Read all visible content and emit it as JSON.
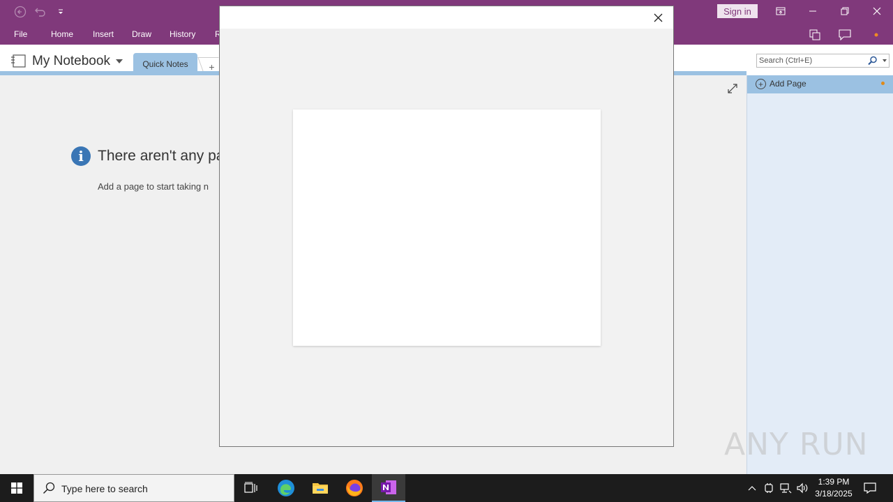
{
  "titlebar": {
    "sign_in": "Sign in",
    "icons": [
      "back-icon",
      "undo-icon",
      "customize-qat-icon",
      "ribbon-display-icon",
      "minimize-icon",
      "restore-icon",
      "close-icon"
    ]
  },
  "ribbon": {
    "tabs": [
      "File",
      "Home",
      "Insert",
      "Draw",
      "History",
      "R"
    ]
  },
  "notebook": {
    "name": "My Notebook",
    "section": "Quick Notes",
    "add_section": "+"
  },
  "search": {
    "placeholder": "Search (Ctrl+E)"
  },
  "content": {
    "empty_title": "There aren't any pa",
    "empty_sub": "Add a page to start taking n"
  },
  "pages": {
    "add_page": "Add Page"
  },
  "watermark": "ANY RUN",
  "taskbar": {
    "search_placeholder": "Type here to search",
    "time": "1:39 PM",
    "date": "3/18/2025"
  },
  "colors": {
    "onenote_purple": "#80397b",
    "section_blue": "#9bc1e2",
    "page_pane": "#e3ecf7",
    "taskbar": "#1c1c1c"
  }
}
